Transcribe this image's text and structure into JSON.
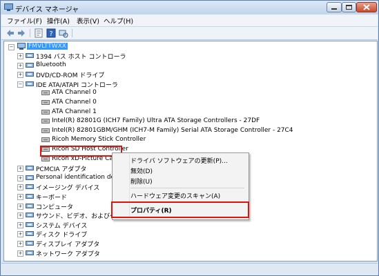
{
  "window": {
    "title": "デバイス マネージャ"
  },
  "menu": [
    {
      "label": "ファイル(F)"
    },
    {
      "label": "操作(A)"
    },
    {
      "label": "表示(V)"
    },
    {
      "label": "ヘルプ(H)"
    }
  ],
  "toolbar": {
    "icons": [
      "back-arrow-icon",
      "forward-arrow-icon",
      "properties-icon",
      "help-icon",
      "scan-hardware-icon"
    ]
  },
  "tree": {
    "root": {
      "label": "FMVLTTWXX"
    },
    "items": [
      {
        "label": "1394 バス ホスト コントローラ",
        "icon": "1394-controller-icon",
        "level": 1,
        "expander": "+"
      },
      {
        "label": "Bluetooth",
        "icon": "bluetooth-icon",
        "level": 1,
        "expander": "+"
      },
      {
        "label": "DVD/CD-ROM ドライブ",
        "icon": "dvd-drive-icon",
        "level": 1,
        "expander": "+"
      },
      {
        "label": "IDE ATA/ATAPI コントローラ",
        "icon": "ide-controller-icon",
        "level": 1,
        "expander": "−"
      },
      {
        "label": "ATA Channel 0",
        "icon": "ide-channel-icon",
        "level": 2
      },
      {
        "label": "ATA Channel 0",
        "icon": "ide-channel-icon",
        "level": 2
      },
      {
        "label": "ATA Channel 1",
        "icon": "ide-channel-icon",
        "level": 2
      },
      {
        "label": "Intel(R) 82801G (ICH7 Family) Ultra ATA Storage Controllers - 27DF",
        "icon": "ide-channel-icon",
        "level": 2
      },
      {
        "label": "Intel(R) 82801GBM/GHM (ICH7-M Family) Serial ATA Storage Controller - 27C4",
        "icon": "ide-channel-icon",
        "level": 2
      },
      {
        "label": "Ricoh Memory Stick Controller",
        "icon": "ide-channel-icon",
        "level": 2
      },
      {
        "label": "Ricoh SD Host Controller",
        "icon": "ide-channel-icon",
        "level": 2
      },
      {
        "label": "Ricoh xD-Picture Card Co",
        "icon": "ide-channel-icon",
        "level": 2
      },
      {
        "label": "PCMCIA アダプタ",
        "icon": "pcmcia-icon",
        "level": 1,
        "expander": "+"
      },
      {
        "label": "Personal identification device",
        "icon": "personal-id-device-icon",
        "level": 1,
        "expander": "+"
      },
      {
        "label": "イメージング デバイス",
        "icon": "imaging-device-icon",
        "level": 1,
        "expander": "+"
      },
      {
        "label": "キーボード",
        "icon": "keyboard-icon",
        "level": 1,
        "expander": "+"
      },
      {
        "label": "コンピュータ",
        "icon": "computer-icon",
        "level": 1,
        "expander": "+"
      },
      {
        "label": "サウンド、ビデオ、およびゲーム コントローラ",
        "icon": "sound-controller-icon",
        "level": 1,
        "expander": "+"
      },
      {
        "label": "システム デバイス",
        "icon": "system-device-icon",
        "level": 1,
        "expander": "+"
      },
      {
        "label": "ディスク ドライブ",
        "icon": "disk-drive-icon",
        "level": 1,
        "expander": "+"
      },
      {
        "label": "ディスプレイ アダプタ",
        "icon": "display-adapter-icon",
        "level": 1,
        "expander": "+"
      },
      {
        "label": "ネットワーク アダプタ",
        "icon": "network-adapter-icon",
        "level": 1,
        "expander": "+"
      }
    ]
  },
  "context_menu": {
    "items": [
      {
        "label": "ドライバ ソフトウェアの更新(P)..."
      },
      {
        "label": "無効(D)"
      },
      {
        "label": "削除(U)"
      },
      {
        "label": "ハードウェア変更のスキャン(A)"
      },
      {
        "label": "プロパティ(R)"
      }
    ]
  },
  "colors": {
    "highlight_box": "#e0130c",
    "selection": "#3399ff"
  }
}
